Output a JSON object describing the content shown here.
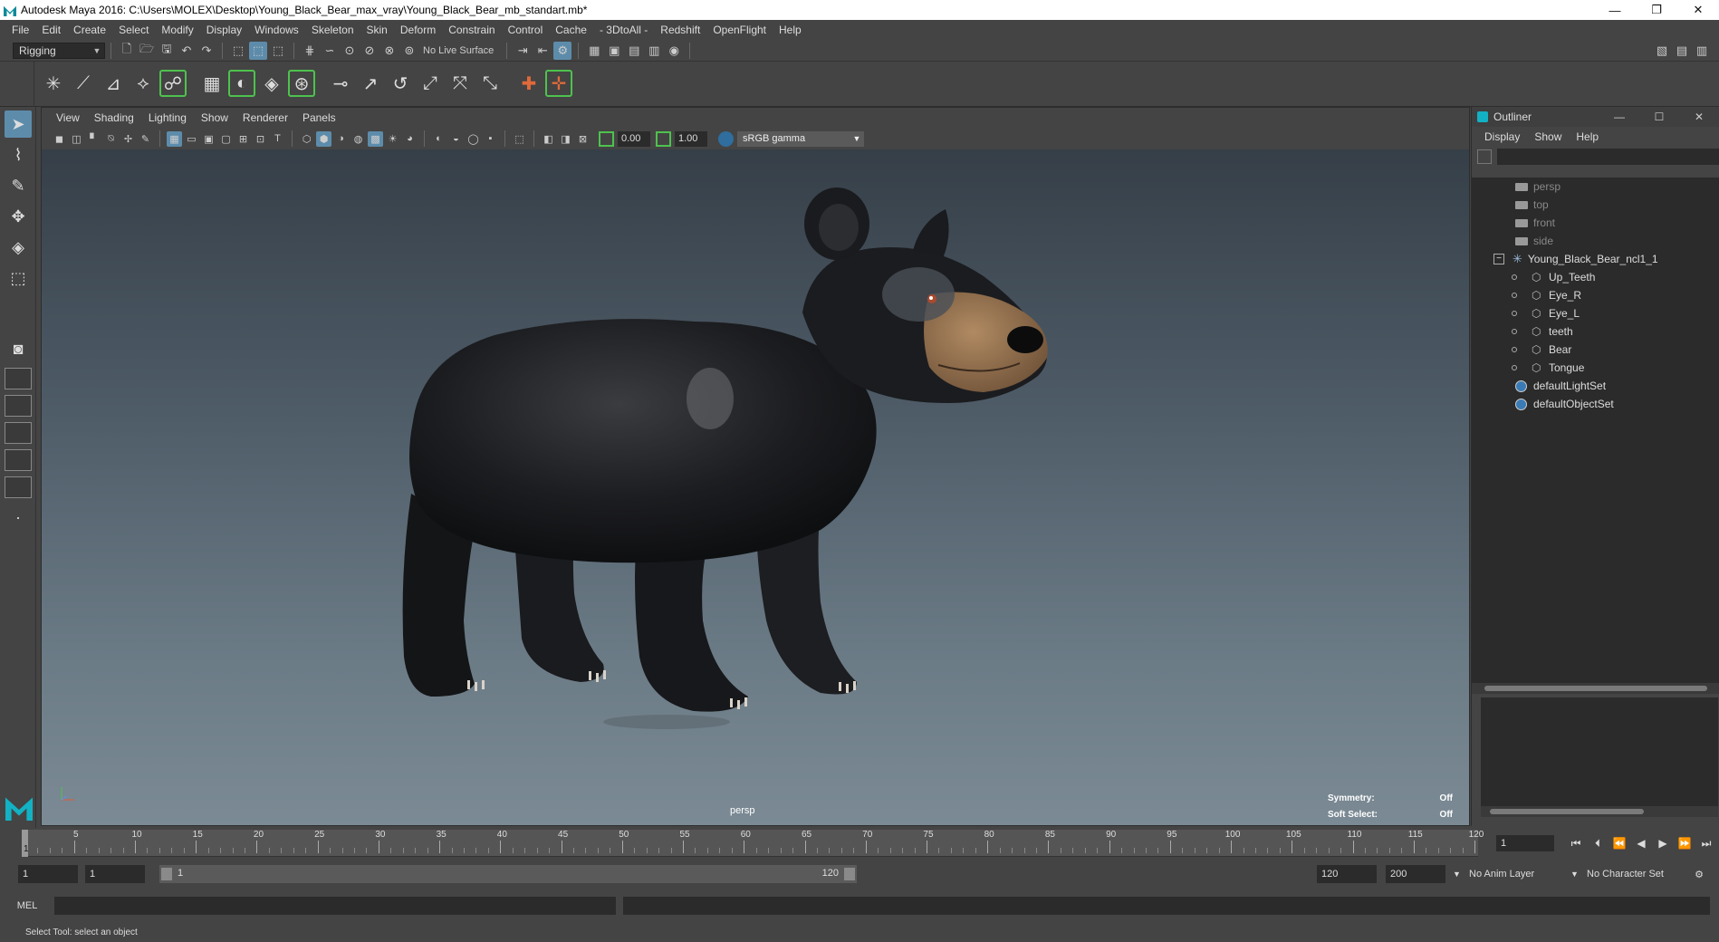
{
  "titlebar": {
    "title": "Autodesk Maya 2016: C:\\Users\\MOLEX\\Desktop\\Young_Black_Bear_max_vray\\Young_Black_Bear_mb_standart.mb*",
    "minimize": "—",
    "restore": "❐",
    "close": "✕"
  },
  "menubar": {
    "items": [
      "File",
      "Edit",
      "Create",
      "Select",
      "Modify",
      "Display",
      "Windows",
      "Skeleton",
      "Skin",
      "Deform",
      "Constrain",
      "Control",
      "Cache",
      "- 3DtoAll -",
      "Redshift",
      "OpenFlight",
      "Help"
    ]
  },
  "statusline": {
    "mode": "Rigging",
    "live_surface": "No Live Surface"
  },
  "viewport_panel": {
    "menu": [
      "View",
      "Shading",
      "Lighting",
      "Show",
      "Renderer",
      "Panels"
    ],
    "exposure": "0.00",
    "gamma_value": "1.00",
    "color_space": "sRGB gamma",
    "camera_label": "persp",
    "symmetry_label": "Symmetry:",
    "symmetry_value": "Off",
    "soft_select_label": "Soft Select:",
    "soft_select_value": "Off"
  },
  "outliner": {
    "title": "Outliner",
    "menu": [
      "Display",
      "Show",
      "Help"
    ],
    "cameras": [
      "persp",
      "top",
      "front",
      "side"
    ],
    "root": "Young_Black_Bear_ncl1_1",
    "children": [
      "Up_Teeth",
      "Eye_R",
      "Eye_L",
      "teeth",
      "Bear",
      "Tongue"
    ],
    "sets": [
      "defaultLightSet",
      "defaultObjectSet"
    ]
  },
  "timeslider": {
    "ticks": [
      "5",
      "10",
      "15",
      "20",
      "25",
      "30",
      "35",
      "40",
      "45",
      "50",
      "55",
      "60",
      "65",
      "70",
      "75",
      "80",
      "85",
      "90",
      "95",
      "100",
      "105",
      "110",
      "115",
      "120"
    ],
    "current_frame_marker": "1",
    "current_frame": "1"
  },
  "rangeslider": {
    "start": "1",
    "playback_start": "1",
    "range_start_label": "1",
    "range_end_label": "120",
    "playback_end": "120",
    "end": "200",
    "anim_layer": "No Anim Layer",
    "character_set": "No Character Set"
  },
  "cmdline": {
    "language": "MEL"
  },
  "helpline": {
    "text": "Select Tool: select an object"
  },
  "colors": {
    "accent": "#5d8cab",
    "maya_teal": "#12b1c3",
    "shelf_highlight": "#4ec24e"
  }
}
